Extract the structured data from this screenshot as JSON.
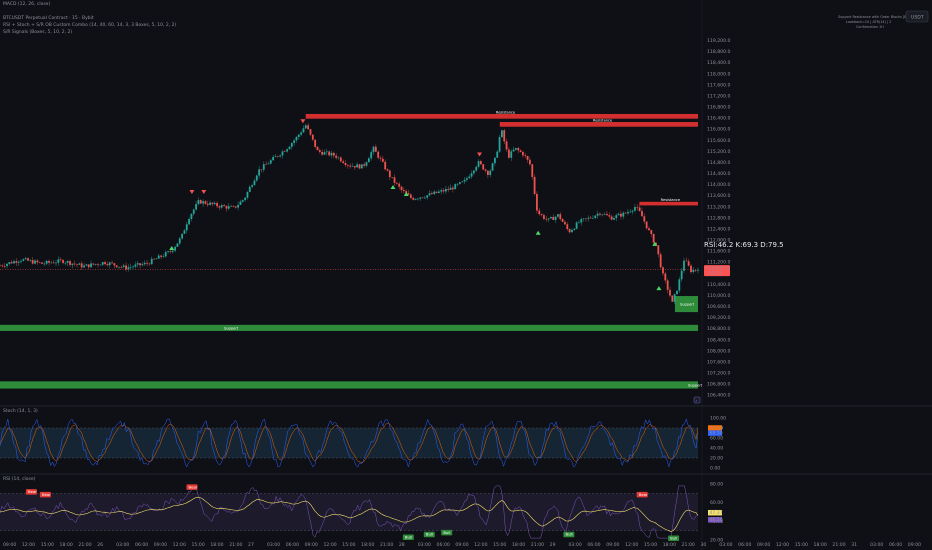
{
  "top_left_label": "MACD (12, 26, close)",
  "legend": {
    "title": "BTCUSDT Perpetual Contract · 15 · Bybit",
    "line2": "RSI + Stoch + S/R OB Custom Combo (14, 40, 60, 14, 3, 3 Boxes, 5, 10, 2, 2)",
    "line3": "S/R Signals (Boxes, 5, 10, 2, 2)"
  },
  "usdt_badge": "USDT",
  "mini_legend": [
    "Support Resistance with Order Blocks [BOSO]",
    "Lookback=10 | ATR(14) | 2",
    "Confirmation 1H"
  ],
  "colors": {
    "bull": "#26a69a",
    "bear": "#ef5350",
    "bull_wick": "#1f8f85",
    "bear_wick": "#c94440",
    "resistance": "#d32f2f",
    "support": "#2e8b3a",
    "price_line": "#ff5252",
    "stoch_k": "#2962ff",
    "stoch_d": "#ff6d00",
    "rsi_line": "#7e57c2",
    "rsi_ma": "#f5e26b"
  },
  "main_axis_labels": [
    "119,200.0",
    "118,800.0",
    "118,400.0",
    "118,000.0",
    "117,600.0",
    "117,200.0",
    "116,800.0",
    "116,400.0",
    "116,000.0",
    "115,600.0",
    "115,200.0",
    "114,800.0",
    "114,400.0",
    "114,000.0",
    "113,600.0",
    "113,200.0",
    "112,800.0",
    "112,400.0",
    "112,000.0",
    "111,600.0",
    "111,200.0",
    "110,800.0",
    "110,400.0",
    "110,000.0",
    "109,600.0",
    "109,200.0",
    "108,800.0",
    "108,400.0",
    "108,000.0",
    "107,600.0",
    "107,200.0",
    "106,800.0",
    "106,400.0"
  ],
  "current_price_label": "110,931.6",
  "current_countdown": "13:11",
  "rsi_readout": "RSI:46.2  K:69.3 D:79.5",
  "resistance_zones": [
    {
      "label": "Resistance",
      "price_top": 116550,
      "price_bottom": 116380,
      "x_start": 0.438,
      "x_end": 1.0
    },
    {
      "label": "Resistance",
      "price_top": 116260,
      "price_bottom": 116090,
      "x_start": 0.716,
      "x_end": 1.0
    },
    {
      "label": "Resistance",
      "price_top": 113380,
      "price_bottom": 113250,
      "x_start": 0.916,
      "x_end": 1.0
    }
  ],
  "support_zones": [
    {
      "label": "Support",
      "price_top": 108940,
      "price_bottom": 108720,
      "x_start": 0.0,
      "x_end": 1.0
    },
    {
      "label": "Support",
      "price_top": 106900,
      "price_bottom": 106640,
      "x_start": 0.0,
      "x_end": 1.0
    },
    {
      "label": "Support",
      "price_top": 109980,
      "price_bottom": 109400,
      "x_start": 0.967,
      "x_end": 1.0
    }
  ],
  "chart_data": [
    {
      "type": "candlestick",
      "title": "BTCUSDT Perpetual Contract · 15 · Bybit",
      "y_range": [
        106300,
        119400
      ],
      "close_path": [
        [
          0.0,
          111080
        ],
        [
          0.03,
          111300
        ],
        [
          0.06,
          111150
        ],
        [
          0.09,
          111250
        ],
        [
          0.12,
          111050
        ],
        [
          0.15,
          111200
        ],
        [
          0.18,
          111000
        ],
        [
          0.21,
          111150
        ],
        [
          0.23,
          111400
        ],
        [
          0.245,
          111600
        ],
        [
          0.26,
          112100
        ],
        [
          0.27,
          112800
        ],
        [
          0.285,
          113400
        ],
        [
          0.31,
          113250
        ],
        [
          0.335,
          113150
        ],
        [
          0.35,
          113500
        ],
        [
          0.37,
          114500
        ],
        [
          0.39,
          114900
        ],
        [
          0.41,
          115300
        ],
        [
          0.425,
          115700
        ],
        [
          0.438,
          116150
        ],
        [
          0.455,
          115200
        ],
        [
          0.48,
          115050
        ],
        [
          0.5,
          114700
        ],
        [
          0.52,
          114650
        ],
        [
          0.535,
          115300
        ],
        [
          0.545,
          114900
        ],
        [
          0.56,
          114250
        ],
        [
          0.575,
          113800
        ],
        [
          0.59,
          113500
        ],
        [
          0.61,
          113600
        ],
        [
          0.625,
          113700
        ],
        [
          0.645,
          113850
        ],
        [
          0.665,
          114100
        ],
        [
          0.685,
          114800
        ],
        [
          0.7,
          114400
        ],
        [
          0.71,
          114950
        ],
        [
          0.718,
          116000
        ],
        [
          0.728,
          115000
        ],
        [
          0.738,
          115300
        ],
        [
          0.75,
          115100
        ],
        [
          0.76,
          114700
        ],
        [
          0.77,
          113000
        ],
        [
          0.785,
          112700
        ],
        [
          0.8,
          112900
        ],
        [
          0.815,
          112300
        ],
        [
          0.83,
          112650
        ],
        [
          0.845,
          112800
        ],
        [
          0.86,
          113000
        ],
        [
          0.875,
          112800
        ],
        [
          0.895,
          112950
        ],
        [
          0.91,
          113200
        ],
        [
          0.918,
          112950
        ],
        [
          0.93,
          112300
        ],
        [
          0.94,
          111800
        ],
        [
          0.95,
          110700
        ],
        [
          0.96,
          110000
        ],
        [
          0.963,
          109700
        ],
        [
          0.972,
          110400
        ],
        [
          0.98,
          111300
        ],
        [
          0.99,
          110900
        ],
        [
          1.0,
          110931.6
        ]
      ],
      "price_line": 110931.6
    },
    {
      "type": "line",
      "title": "Stoch (14, 1, 3)",
      "y_range": [
        0,
        100
      ],
      "axis_labels": [
        "100.00",
        "80.00",
        "60.00",
        "40.00",
        "20.00",
        "0.00"
      ],
      "bands": [
        20,
        80
      ],
      "last_values": {
        "k": 69.3,
        "d": 79.5
      }
    },
    {
      "type": "line",
      "title": "RSI (14, close)",
      "y_range": [
        20,
        80
      ],
      "axis_labels": [
        "80.00",
        "60.00",
        "40.00",
        "20.00"
      ],
      "last_values": {
        "rsi": 47.37,
        "ma": 46.2
      },
      "bands": [
        30,
        70
      ],
      "signals": [
        {
          "label": "Bear",
          "x": 0.045,
          "v": 66
        },
        {
          "label": "Bear",
          "x": 0.065,
          "v": 63
        },
        {
          "label": "Bear",
          "x": 0.275,
          "v": 71
        },
        {
          "label": "Bull",
          "x": 0.585,
          "v": 28
        },
        {
          "label": "Bull",
          "x": 0.615,
          "v": 31
        },
        {
          "label": "Bull",
          "x": 0.64,
          "v": 33
        },
        {
          "label": "Bull",
          "x": 0.815,
          "v": 31
        },
        {
          "label": "Bear",
          "x": 0.92,
          "v": 63
        },
        {
          "label": "Bull",
          "x": 0.965,
          "v": 27
        }
      ]
    }
  ],
  "time_axis_labels": [
    "09:00",
    "12:00",
    "15:00",
    "18:00",
    "21:00",
    "26",
    "03:00",
    "06:00",
    "09:00",
    "12:00",
    "15:00",
    "18:00",
    "21:00",
    "27",
    "03:00",
    "06:00",
    "09:00",
    "12:00",
    "15:00",
    "18:00",
    "21:00",
    "28",
    "03:00",
    "06:00",
    "09:00",
    "12:00",
    "15:00",
    "18:00",
    "21:00",
    "29",
    "03:00",
    "06:00",
    "09:00",
    "12:00",
    "15:00",
    "18:00",
    "21:00",
    "30",
    "03:00",
    "06:00",
    "09:00",
    "12:00",
    "15:00",
    "18:00",
    "21:00",
    "31",
    "03:00",
    "06:00",
    "09:00"
  ]
}
